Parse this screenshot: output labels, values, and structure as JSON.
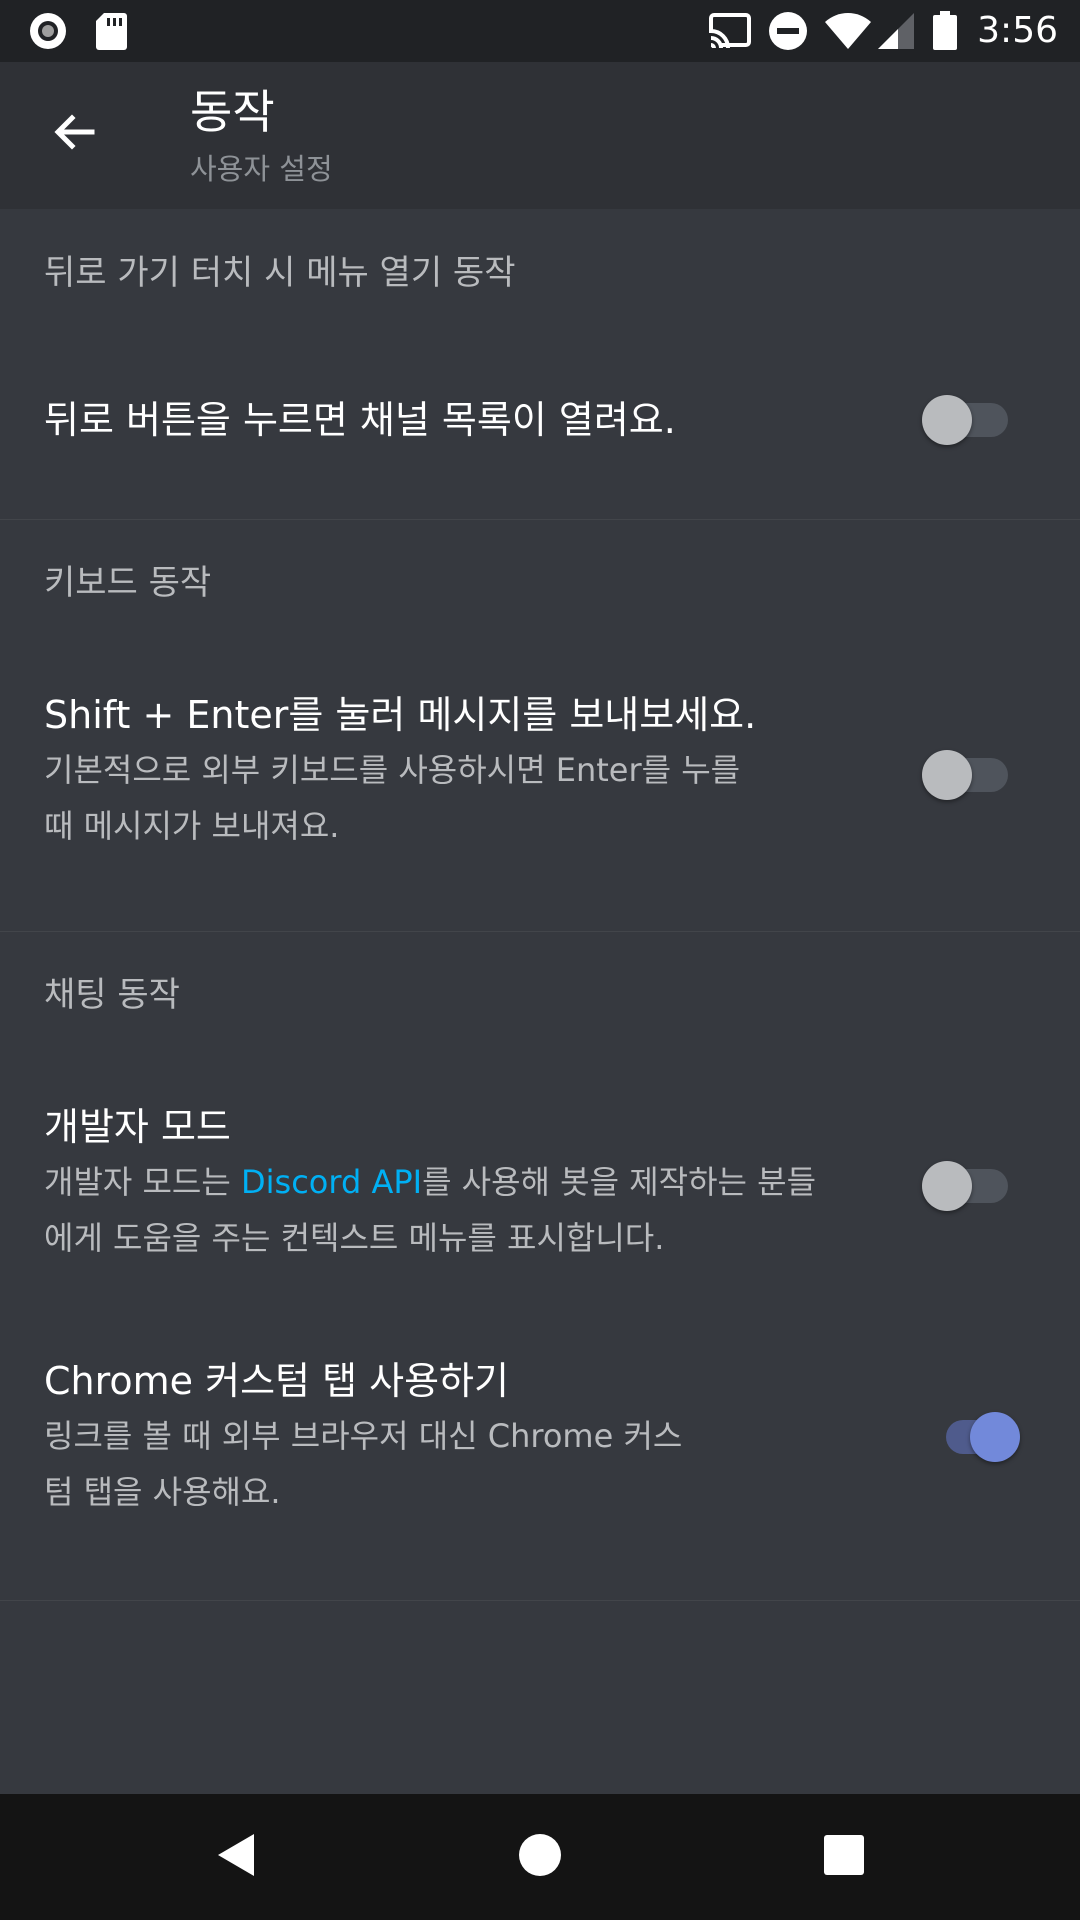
{
  "status_bar": {
    "time": "3:56",
    "icons": [
      "record-icon",
      "sd-card-icon",
      "cast-icon",
      "do-not-disturb-icon",
      "wifi-icon",
      "signal-icon",
      "battery-icon"
    ]
  },
  "app_bar": {
    "title": "동작",
    "subtitle": "사용자 설정",
    "back_icon": "arrow-back-icon"
  },
  "sections": [
    {
      "header": "뒤로 가기 터치 시 메뉴 열기 동작",
      "settings": [
        {
          "title": "뒤로 버튼을 누르면 채널 목록이 열려요.",
          "enabled": false
        }
      ]
    },
    {
      "header": "키보드 동작",
      "settings": [
        {
          "title": "Shift + Enter를 눌러 메시지를 보내보세요.",
          "desc_line1": "기본적으로 외부 키보드를 사용하시면 Enter를 누를",
          "desc_line2": "때 메시지가 보내져요.",
          "enabled": false
        }
      ]
    },
    {
      "header": "채팅 동작",
      "settings": [
        {
          "title": "개발자 모드",
          "desc_line1_pre": "개발자 모드는 ",
          "desc_line1_link": "Discord API",
          "desc_line1_post": "를 사용해 봇을 제작하는 분들",
          "desc_line2": "에게 도움을 주는 컨텍스트 메뉴를 표시합니다.",
          "enabled": false
        },
        {
          "title": "Chrome 커스텀 탭 사용하기",
          "desc_line1": "링크를 볼 때 외부 브라우저 대신 Chrome 커스",
          "desc_line2": "텀 탭을 사용해요.",
          "enabled": true
        }
      ]
    }
  ],
  "nav_bar": {
    "icons": [
      "back-triangle-icon",
      "home-circle-icon",
      "recents-square-icon"
    ]
  },
  "colors": {
    "background": "#36393f",
    "app_bar": "#2f3136",
    "status_bar": "#202225",
    "link": "#00b0f4",
    "toggle_on": "#7289da",
    "toggle_off": "#b9bbbe"
  }
}
